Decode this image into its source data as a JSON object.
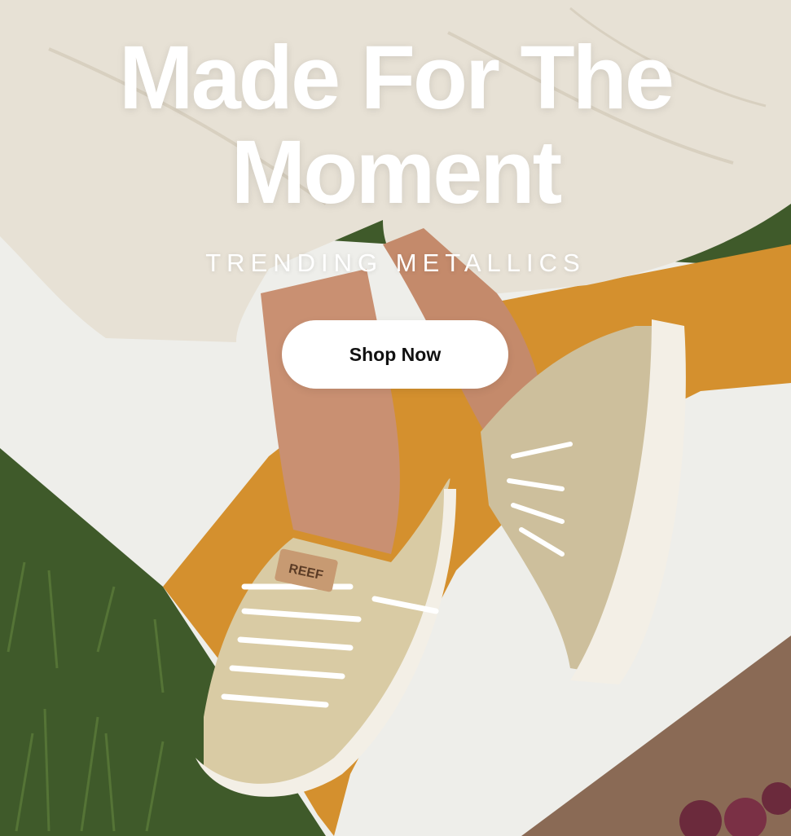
{
  "hero": {
    "headline_line1": "Made For The",
    "headline_line2": "Moment",
    "subheadline": "TRENDING METALLICS",
    "cta_label": "Shop Now",
    "brand_tag": "REEF"
  },
  "colors": {
    "grass": "#3f5a2a",
    "towel_white": "#eeeeea",
    "towel_orange": "#d4902e",
    "towel_brown": "#8a6a55",
    "pants": "#e7e1d5",
    "skin": "#c99072",
    "shoe_gold": "#cdbf9c",
    "sole": "#f3efe6",
    "button_bg": "#ffffff",
    "button_text": "#111111"
  }
}
